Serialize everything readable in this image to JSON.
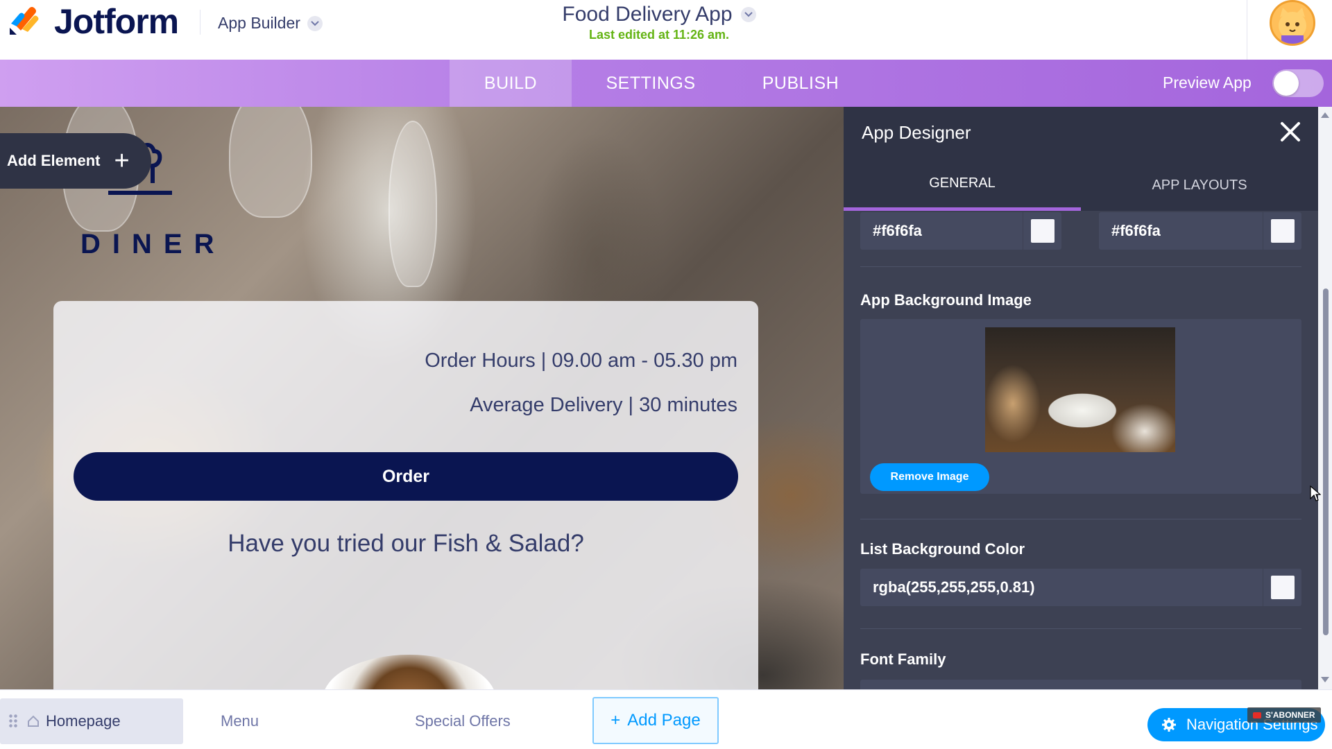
{
  "header": {
    "brand": "Jotform",
    "builder_label": "App Builder",
    "app_title": "Food Delivery App",
    "last_edited": "Last edited at 11:26 am."
  },
  "nav": {
    "tabs": [
      {
        "label": "BUILD",
        "active": true
      },
      {
        "label": "SETTINGS",
        "active": false
      },
      {
        "label": "PUBLISH",
        "active": false
      }
    ],
    "preview_label": "Preview App",
    "preview_on": false
  },
  "canvas": {
    "add_element_label": "Add Element",
    "logo_text": "DINER",
    "order_hours": "Order Hours | 09.00 am - 05.30 pm",
    "average_delivery": "Average Delivery | 30 minutes",
    "order_button": "Order",
    "promo_text": "Have you tried our Fish & Salad?"
  },
  "designer": {
    "title": "App Designer",
    "tabs": [
      {
        "label": "GENERAL",
        "active": true
      },
      {
        "label": "APP LAYOUTS",
        "active": false
      }
    ],
    "color_left": "#f6f6fa",
    "color_right": "#f6f6fa",
    "bg_image_label": "App Background Image",
    "remove_image_label": "Remove Image",
    "list_bg_label": "List Background Color",
    "list_bg_value": "rgba(255,255,255,0.81)",
    "font_family_label": "Font Family"
  },
  "pages": {
    "tabs": [
      {
        "label": "Homepage",
        "active": true
      },
      {
        "label": "Menu",
        "active": false
      },
      {
        "label": "Special Offers",
        "active": false
      }
    ],
    "add_page_label": "Add Page",
    "nav_settings_label": "Navigation Settings"
  },
  "overlay": {
    "subscribe_label": "S'ABONNER"
  },
  "colors": {
    "primary_navy": "#0a1551",
    "accent_purple": "#a465dc",
    "action_blue": "#0099ff",
    "panel_dark": "#3d4153",
    "success_green": "#64b414"
  }
}
